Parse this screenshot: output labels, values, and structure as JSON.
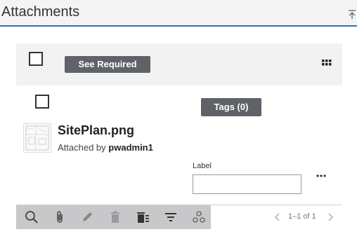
{
  "header": {
    "title": "Attachments"
  },
  "panel": {
    "see_required_label": "See Required"
  },
  "attachment": {
    "tags_label": "Tags (0)",
    "filename": "SitePlan.png",
    "attached_by_prefix": "Attached by",
    "attached_by_user": "pwadmin1",
    "label_caption": "Label",
    "label_value": ""
  },
  "toolbar": {
    "icons": [
      "search-icon",
      "paperclip-icon",
      "pencil-icon",
      "trash-icon",
      "delete-multiple-icon",
      "filter-icon",
      "settings-cluster-icon"
    ]
  },
  "pager": {
    "text": "1–1 of 1"
  },
  "colors": {
    "accent": "#2f6db0",
    "button_dark": "#5f6367",
    "toolbar_bg": "#c8c8cb"
  }
}
